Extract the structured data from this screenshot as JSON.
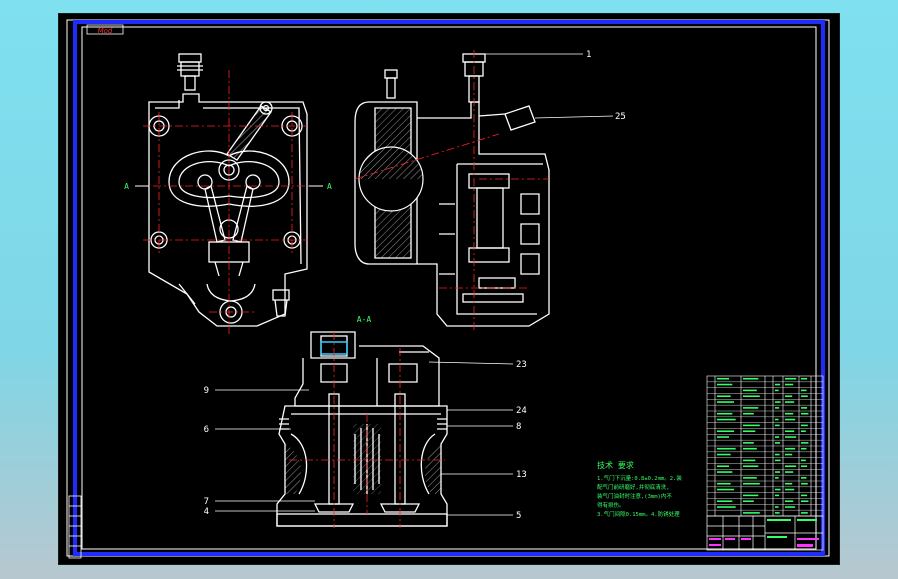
{
  "drawing": {
    "corner_tag": "Mod",
    "section_label": "A-A",
    "section_marks": {
      "left": "A",
      "right": "A"
    },
    "callouts": [
      {
        "id": "1",
        "text": "1"
      },
      {
        "id": "25",
        "text": "25"
      },
      {
        "id": "23",
        "text": "23"
      },
      {
        "id": "24",
        "text": "24"
      },
      {
        "id": "8",
        "text": "8"
      },
      {
        "id": "13",
        "text": "13"
      },
      {
        "id": "5",
        "text": "5"
      },
      {
        "id": "9",
        "text": "9"
      },
      {
        "id": "6",
        "text": "6"
      },
      {
        "id": "7",
        "text": "7"
      },
      {
        "id": "4",
        "text": "4"
      }
    ],
    "notes": {
      "heading": "技术  要求",
      "lines": [
        "1.气门下沉量:0.8±0.2mm。2.装",
        "配气门前研磨好,并彻底清洗,",
        "装气门油封时注意,(3mm)内不",
        "得有损伤。",
        "3.气门间隙0.15mm。4.防锈处理"
      ]
    },
    "colors": {
      "sheet": "#000000",
      "border": "#1f2bff",
      "lines": "#ffffff",
      "centerlines": "#ff2222",
      "text_green": "#33ff66",
      "title_magenta": "#ff33ff"
    }
  }
}
